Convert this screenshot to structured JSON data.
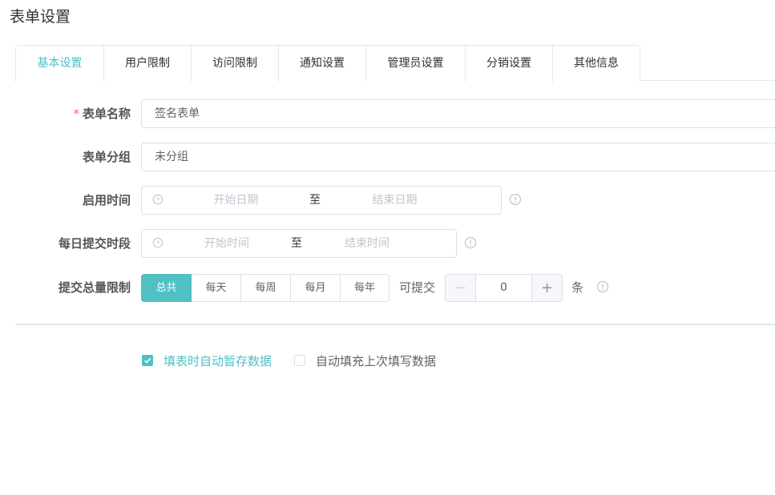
{
  "page": {
    "title": "表单设置"
  },
  "tabs": [
    {
      "label": "基本设置",
      "active": true
    },
    {
      "label": "用户限制",
      "active": false
    },
    {
      "label": "访问限制",
      "active": false
    },
    {
      "label": "通知设置",
      "active": false
    },
    {
      "label": "管理员设置",
      "active": false
    },
    {
      "label": "分销设置",
      "active": false
    },
    {
      "label": "其他信息",
      "active": false
    }
  ],
  "form": {
    "name": {
      "required_mark": "*",
      "label": "表单名称",
      "value": "签名表单"
    },
    "group": {
      "label": "表单分组",
      "value": "未分组"
    },
    "enable_time": {
      "label": "启用时间",
      "start_placeholder": "开始日期",
      "separator": "至",
      "end_placeholder": "结束日期"
    },
    "daily_period": {
      "label": "每日提交时段",
      "start_placeholder": "开始时间",
      "separator": "至",
      "end_placeholder": "结束时间"
    },
    "submit_limit": {
      "label": "提交总量限制",
      "options": [
        "总共",
        "每天",
        "每周",
        "每月",
        "每年"
      ],
      "selected": "总共",
      "prefix": "可提交",
      "value": "0",
      "minus": "−",
      "plus": "+",
      "unit": "条"
    }
  },
  "options": {
    "auto_save": {
      "label": "填表时自动暂存数据",
      "checked": true
    },
    "auto_fill": {
      "label": "自动填充上次填写数据",
      "checked": false
    }
  },
  "colors": {
    "accent": "#4fc0c3",
    "required": "#f56c6c",
    "border": "#dcdfe6",
    "placeholder": "#c0c4cc"
  },
  "icons": {
    "time": "clock-icon",
    "hint": "info-circle-icon",
    "check": "checkmark-icon"
  }
}
